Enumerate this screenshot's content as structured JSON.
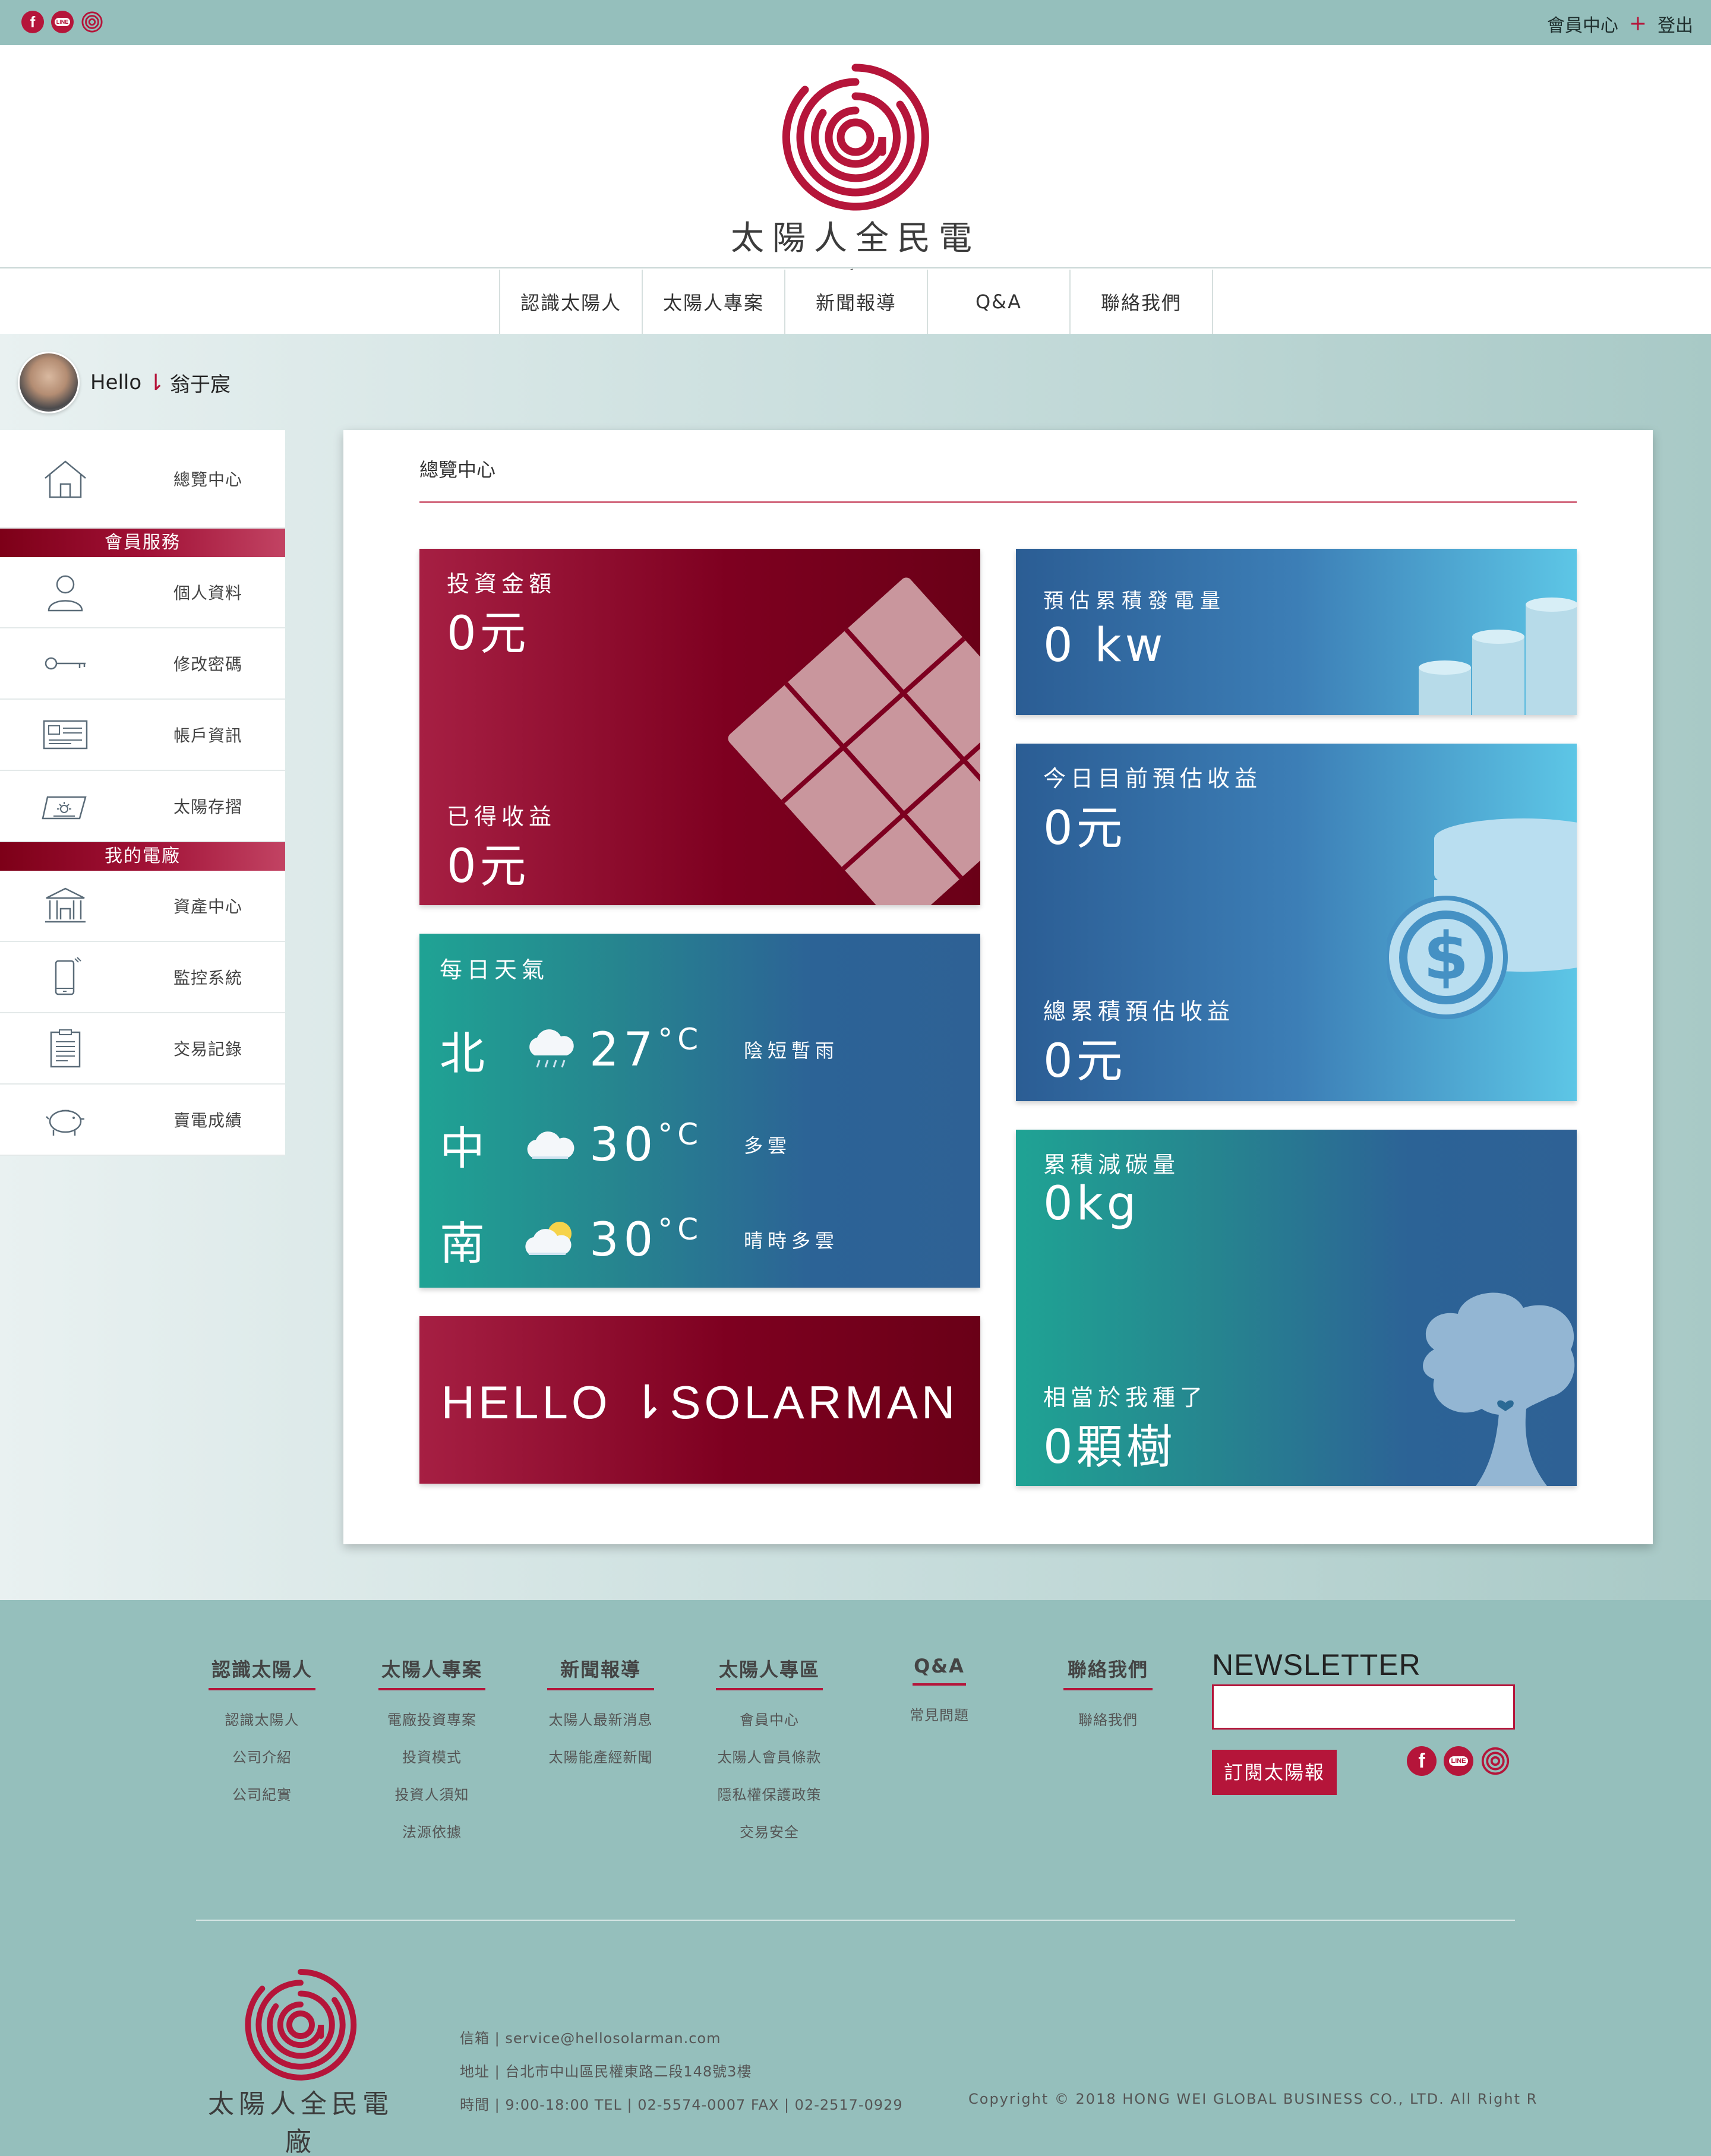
{
  "topbar": {
    "social": [
      "facebook-icon",
      "line-icon",
      "at-logo-icon"
    ],
    "line_text": "LINE",
    "fb_text": "f",
    "member_center": "會員中心",
    "plus": "+",
    "logout": "登出"
  },
  "brand": {
    "name": "太陽人全民電廠",
    "color": "#b5153a"
  },
  "nav": [
    "認識太陽人",
    "太陽人專案",
    "新聞報導",
    "Q&A",
    "聯絡我們"
  ],
  "user": {
    "hello": "Hello",
    "arrow": "⇂",
    "name": "翁于宸"
  },
  "sidebar": {
    "overview": "總覽中心",
    "member_services_header": "會員服務",
    "member_services": [
      "個人資料",
      "修改密碼",
      "帳戶資訊",
      "太陽存摺"
    ],
    "my_plant_header": "我的電廠",
    "my_plant": [
      "資產中心",
      "監控系統",
      "交易記錄",
      "賣電成績"
    ]
  },
  "panel": {
    "title": "總覽中心",
    "investment": {
      "label": "投資金額",
      "value": "0元"
    },
    "earned": {
      "label": "已得收益",
      "value": "0元"
    },
    "power": {
      "label": "預估累積發電量",
      "value": "0 kw"
    },
    "today_income": {
      "label": "今日目前預估收益",
      "value": "0元"
    },
    "total_income": {
      "label": "總累積預估收益",
      "value": "0元"
    },
    "weather": {
      "title": "每日天氣",
      "rows": [
        {
          "city": "北",
          "temp": "27",
          "unit": "°C",
          "desc": "陰短暫雨",
          "icon": "rain-cloud-icon"
        },
        {
          "city": "中",
          "temp": "30",
          "unit": "°C",
          "desc": "多雲",
          "icon": "cloud-icon"
        },
        {
          "city": "南",
          "temp": "30",
          "unit": "°C",
          "desc": "晴時多雲",
          "icon": "sun-cloud-icon"
        }
      ]
    },
    "carbon": {
      "label": "累積減碳量",
      "value": "0kg"
    },
    "trees": {
      "label": "相當於我種了",
      "value": "0顆樹"
    },
    "banner": "HELLO ⇂SOLARMAN"
  },
  "footer": {
    "columns": [
      {
        "title": "認識太陽人",
        "links": [
          "認識太陽人",
          "公司介紹",
          "公司紀實"
        ]
      },
      {
        "title": "太陽人專案",
        "links": [
          "電廠投資專案",
          "投資模式",
          "投資人須知",
          "法源依據"
        ]
      },
      {
        "title": "新聞報導",
        "links": [
          "太陽人最新消息",
          "太陽能產經新聞"
        ]
      },
      {
        "title": "太陽人專區",
        "links": [
          "會員中心",
          "太陽人會員條款",
          "隱私權保護政策",
          "交易安全"
        ]
      },
      {
        "title": "Q&A",
        "links": [
          "常見問題"
        ]
      },
      {
        "title": "聯絡我們",
        "links": [
          "聯絡我們"
        ]
      }
    ],
    "newsletter_title": "NEWSLETTER",
    "newsletter_value": "",
    "subscribe": "訂閱太陽報",
    "email_line": "信箱 | service@hellosolarman.com",
    "address_line": "地址 | 台北市中山區民權東路二段148號3樓",
    "hours_line": "時間 | 9:00-18:00 TEL | 02-5574-0007 FAX | 02-2517-0929",
    "copyright": "Copyright © 2018 HONG WEI GLOBAL BUSINESS CO., LTD. All Right R"
  }
}
